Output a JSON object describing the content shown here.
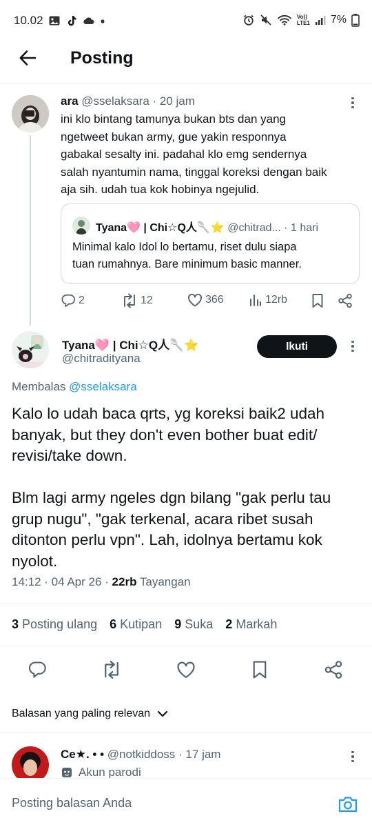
{
  "status_bar": {
    "time": "10.02",
    "left_icons": [
      "gallery-icon",
      "tiktok-icon",
      "cloud-icon",
      "dot-icon"
    ],
    "right_icons": [
      "alarm-icon",
      "mute-icon",
      "wifi-icon",
      "signal-icon",
      "battery-icon"
    ],
    "network_label_top": "Vo))",
    "network_label_bottom": "LTE1",
    "battery": "7%"
  },
  "header": {
    "title": "Posting"
  },
  "parent_tweet": {
    "name": "ara",
    "handle": "@sselaksara",
    "time": "· 20 jam",
    "text": "ini klo bintang tamunya bukan bts dan yang\nngetweet bukan army, gue yakin  responnya\ngabakal sesalty ini. padahal klo emg sendernya\nsalah nyantumin nama, tinggal koreksi dengan baik\naja sih. udah tua kok hobinya ngejulid.",
    "quote": {
      "name": "Tyana🩷 | Chi☆Q人🥄⭐",
      "handle": "@chitrad...",
      "time": "· 1 hari",
      "text": "Minimal kalo Idol lo bertamu, riset dulu siapa\ntuan rumahnya. Bare minimum basic manner."
    },
    "actions": {
      "replies": "2",
      "reposts": "12",
      "likes": "366",
      "views": "12rb"
    }
  },
  "main_tweet": {
    "name": "Tyana🩷 | Chi☆Q人🥄⭐",
    "handle": "@chitradityana",
    "follow_label": "Ikuti",
    "reply_prefix": "Membalas",
    "reply_handle": "@sselaksara",
    "text": "Kalo lo udah baca qrts, yg koreksi baik2 udah\nbanyak, but they don't even bother buat edit/\nrevisi/take down.\n\nBlm lagi army ngeles dgn bilang \"gak perlu tau\ngrup nugu\", \"gak terkenal, acara ribet susah\nditonton perlu vpn\". Lah, idolnya bertamu kok\nnyolot.",
    "timestamp": "14:12 · 04 Apr 26 · ",
    "views_count": "22rb",
    "views_label": " Tayangan",
    "stats": [
      {
        "count": "3",
        "label": "Posting ulang"
      },
      {
        "count": "6",
        "label": "Kutipan"
      },
      {
        "count": "9",
        "label": "Suka"
      },
      {
        "count": "2",
        "label": "Markah"
      }
    ]
  },
  "sort": {
    "label": "Balasan yang paling relevan"
  },
  "reply_preview": {
    "name": "Ce★. • •",
    "handle": "@notkiddoss",
    "time": "· 17 jam",
    "badge": "Akun parodi"
  },
  "composer": {
    "placeholder": "Posting balasan Anda"
  },
  "colors": {
    "accent": "#1d9bf0",
    "text": "#0f1419",
    "muted": "#536471",
    "border": "#cfd9de"
  }
}
